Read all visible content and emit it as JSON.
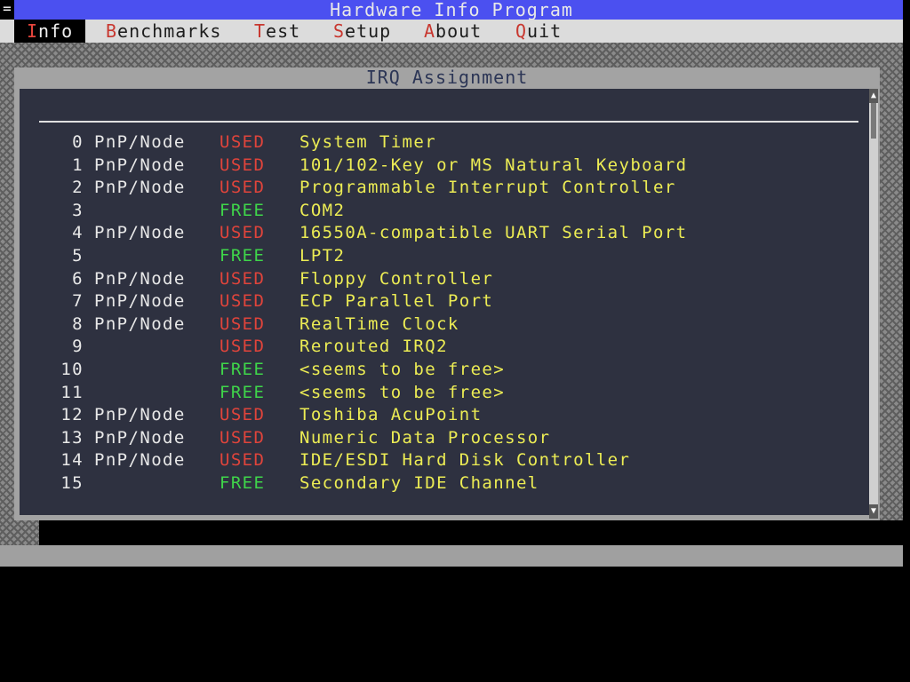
{
  "app": {
    "title": "Hardware Info Program",
    "system_box": "="
  },
  "menu": [
    {
      "hot": "I",
      "rest": "nfo",
      "active": true
    },
    {
      "hot": "B",
      "rest": "enchmarks",
      "active": false
    },
    {
      "hot": "T",
      "rest": "est",
      "active": false
    },
    {
      "hot": "S",
      "rest": "etup",
      "active": false
    },
    {
      "hot": "A",
      "rest": "bout",
      "active": false
    },
    {
      "hot": "Q",
      "rest": "uit",
      "active": false
    }
  ],
  "window": {
    "title": "IRQ Assignment"
  },
  "scrollbar": {
    "up": "▲",
    "down": "▼"
  },
  "irq_rows": [
    {
      "num": "0",
      "type": "PnP/Node",
      "status": "USED",
      "desc": "System Timer"
    },
    {
      "num": "1",
      "type": "PnP/Node",
      "status": "USED",
      "desc": "101/102-Key or MS Natural Keyboard"
    },
    {
      "num": "2",
      "type": "PnP/Node",
      "status": "USED",
      "desc": "Programmable Interrupt Controller"
    },
    {
      "num": "3",
      "type": "",
      "status": "FREE",
      "desc": "COM2"
    },
    {
      "num": "4",
      "type": "PnP/Node",
      "status": "USED",
      "desc": "16550A-compatible UART Serial Port"
    },
    {
      "num": "5",
      "type": "",
      "status": "FREE",
      "desc": "LPT2"
    },
    {
      "num": "6",
      "type": "PnP/Node",
      "status": "USED",
      "desc": "Floppy Controller"
    },
    {
      "num": "7",
      "type": "PnP/Node",
      "status": "USED",
      "desc": "ECP Parallel Port"
    },
    {
      "num": "8",
      "type": "PnP/Node",
      "status": "USED",
      "desc": "RealTime Clock"
    },
    {
      "num": "9",
      "type": "",
      "status": "USED",
      "desc": "Rerouted IRQ2"
    },
    {
      "num": "10",
      "type": "",
      "status": "FREE",
      "desc": "<seems to be free>"
    },
    {
      "num": "11",
      "type": "",
      "status": "FREE",
      "desc": "<seems to be free>"
    },
    {
      "num": "12",
      "type": "PnP/Node",
      "status": "USED",
      "desc": "Toshiba AcuPoint"
    },
    {
      "num": "13",
      "type": "PnP/Node",
      "status": "USED",
      "desc": "Numeric Data Processor"
    },
    {
      "num": "14",
      "type": "PnP/Node",
      "status": "USED",
      "desc": "IDE/ESDI Hard Disk Controller"
    },
    {
      "num": "15",
      "type": "",
      "status": "FREE",
      "desc": "Secondary IDE Channel"
    }
  ],
  "colors": {
    "titlebar": "#4b50f0",
    "used": "#e0443b",
    "free": "#3fd64a",
    "description": "#ecec54",
    "panel": "#2e3140"
  }
}
